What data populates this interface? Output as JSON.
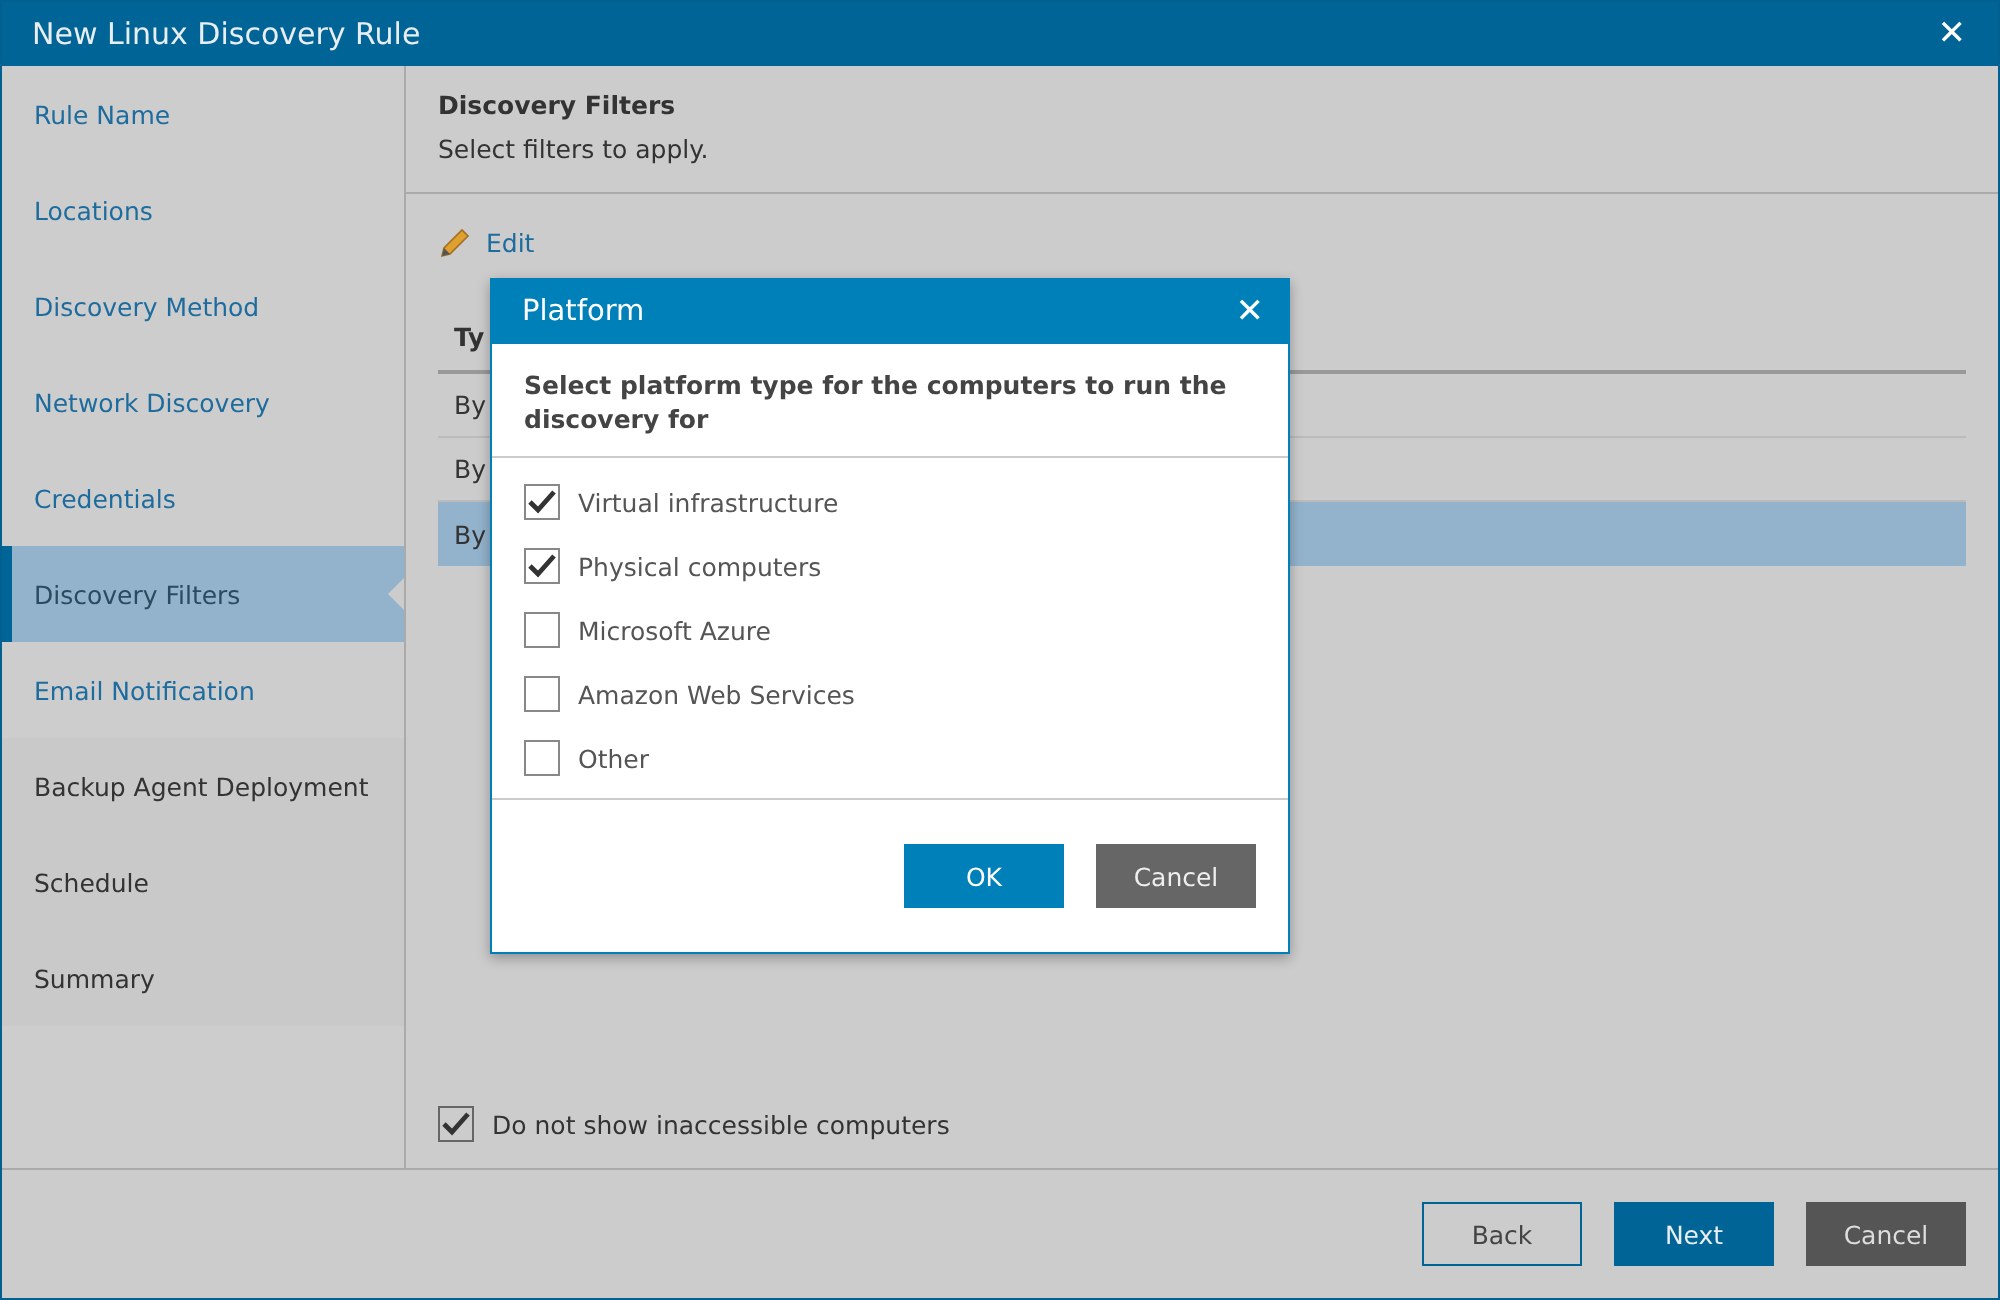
{
  "window": {
    "title": "New Linux Discovery Rule",
    "close": "✕"
  },
  "sidebar": {
    "items": [
      {
        "label": "Rule Name",
        "visited": true,
        "selected": false
      },
      {
        "label": "Locations",
        "visited": true,
        "selected": false
      },
      {
        "label": "Discovery Method",
        "visited": true,
        "selected": false
      },
      {
        "label": "Network Discovery",
        "visited": true,
        "selected": false
      },
      {
        "label": "Credentials",
        "visited": true,
        "selected": false
      },
      {
        "label": "Discovery Filters",
        "visited": true,
        "selected": true
      },
      {
        "label": "Email Notification",
        "visited": true,
        "selected": false
      },
      {
        "label": "Backup Agent Deployment",
        "visited": false,
        "selected": false
      },
      {
        "label": "Schedule",
        "visited": false,
        "selected": false
      },
      {
        "label": "Summary",
        "visited": false,
        "selected": false
      }
    ]
  },
  "content": {
    "title": "Discovery Filters",
    "subtitle": "Select filters to apply.",
    "edit": "Edit",
    "table": {
      "header": "Ty",
      "rows": [
        {
          "cell": "By",
          "selected": false
        },
        {
          "cell": "By",
          "selected": false
        },
        {
          "cell": "By",
          "selected": true
        }
      ]
    },
    "hide_inaccessible": {
      "label": "Do not show inaccessible computers",
      "checked": true
    }
  },
  "dialog": {
    "title": "Platform",
    "close": "✕",
    "prompt": "Select platform type for the computers to run the discovery for",
    "options": [
      {
        "label": "Virtual infrastructure",
        "checked": true
      },
      {
        "label": "Physical computers",
        "checked": true
      },
      {
        "label": "Microsoft Azure",
        "checked": false
      },
      {
        "label": "Amazon Web Services",
        "checked": false
      },
      {
        "label": "Other",
        "checked": false
      }
    ],
    "buttons": [
      {
        "label": "OK",
        "kind": "primary"
      },
      {
        "label": "Cancel",
        "kind": "secondary"
      }
    ]
  },
  "footer": {
    "buttons": [
      {
        "label": "Back",
        "kind": "outline"
      },
      {
        "label": "Next",
        "kind": "primary"
      },
      {
        "label": "Cancel",
        "kind": "secondary"
      }
    ]
  }
}
